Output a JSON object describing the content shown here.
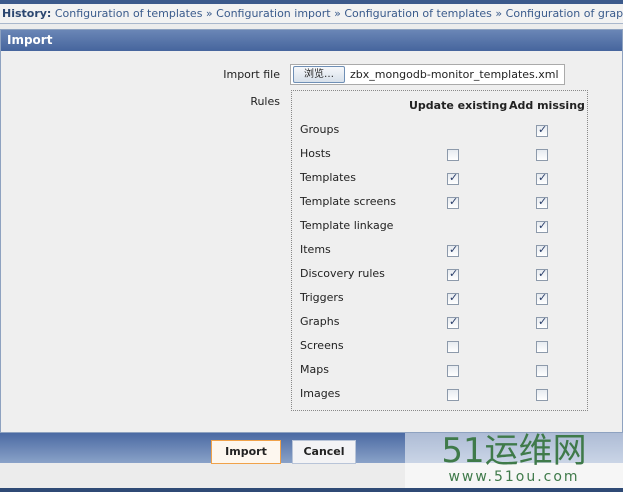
{
  "history": {
    "label": "History:",
    "items": [
      "Configuration of templates",
      "Configuration import",
      "Configuration of templates",
      "Configuration of graphs"
    ]
  },
  "panel": {
    "title": "Import"
  },
  "form": {
    "import_file_label": "Import file",
    "browse_label": "浏览…",
    "file_name": "zbx_mongodb-monitor_templates.xml",
    "rules_label": "Rules",
    "col_update": "Update existing",
    "col_add": "Add missing"
  },
  "rules": [
    {
      "name": "Groups",
      "update": null,
      "add": true
    },
    {
      "name": "Hosts",
      "update": false,
      "add": false
    },
    {
      "name": "Templates",
      "update": true,
      "add": true
    },
    {
      "name": "Template screens",
      "update": true,
      "add": true
    },
    {
      "name": "Template linkage",
      "update": null,
      "add": true
    },
    {
      "name": "Items",
      "update": true,
      "add": true
    },
    {
      "name": "Discovery rules",
      "update": true,
      "add": true
    },
    {
      "name": "Triggers",
      "update": true,
      "add": true
    },
    {
      "name": "Graphs",
      "update": true,
      "add": true
    },
    {
      "name": "Screens",
      "update": false,
      "add": false
    },
    {
      "name": "Maps",
      "update": false,
      "add": false
    },
    {
      "name": "Images",
      "update": false,
      "add": false
    }
  ],
  "buttons": {
    "import": "Import",
    "cancel": "Cancel"
  },
  "watermark": {
    "logo": "51运维网",
    "url": "www.51ou.com"
  }
}
